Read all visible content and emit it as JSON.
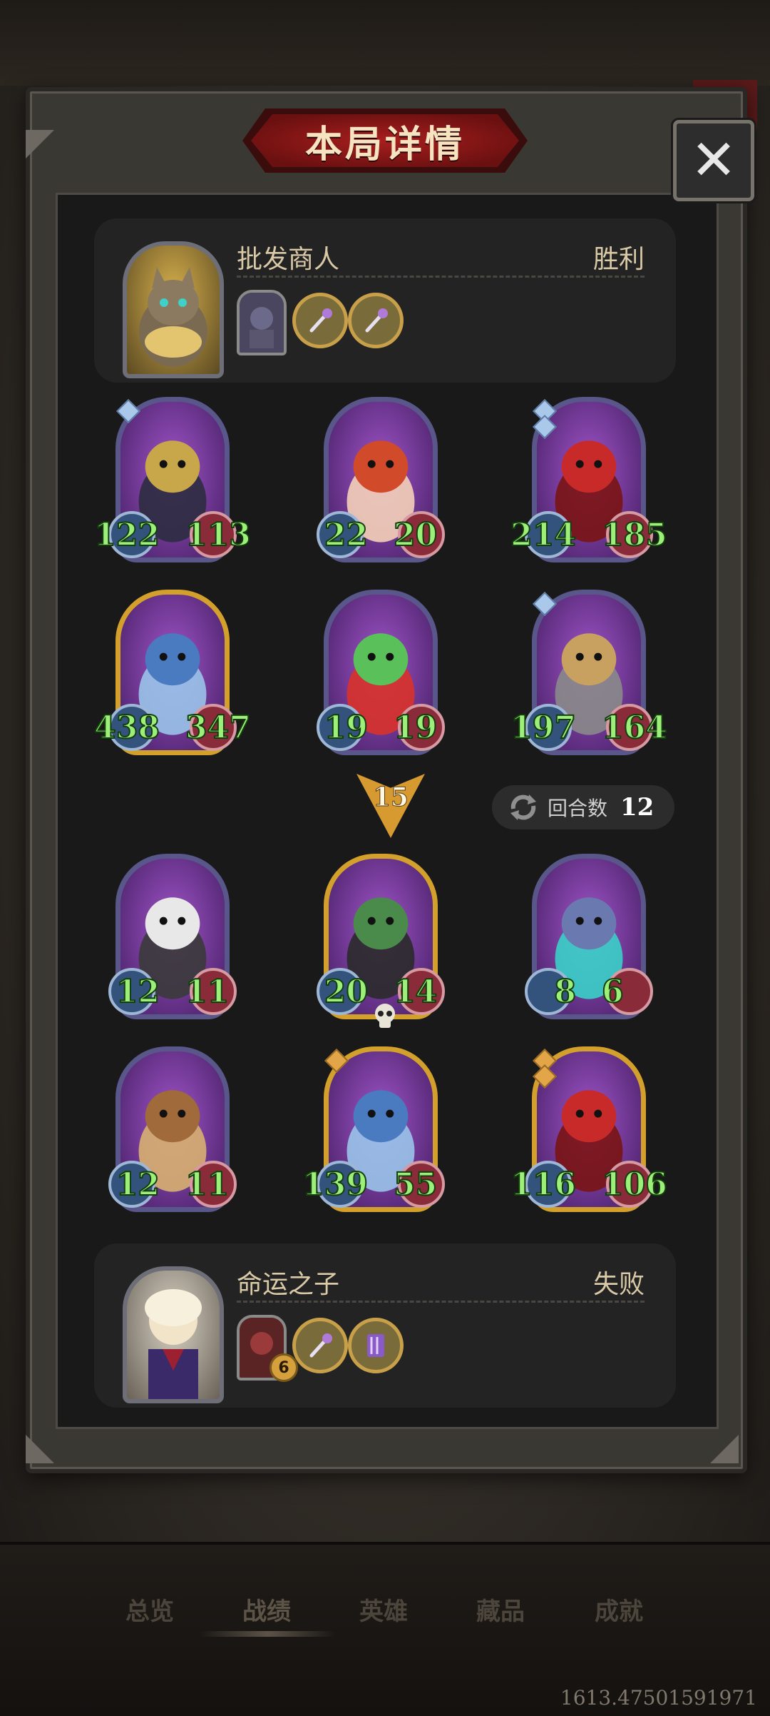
{
  "dialog": {
    "title": "本局详情",
    "close_label": "✕"
  },
  "top_player": {
    "name": "批发商人",
    "result": "胜利",
    "items": [
      {
        "icon": "card-portrait-icon",
        "type": "rect"
      },
      {
        "icon": "magic-wand-icon",
        "type": "circle"
      },
      {
        "icon": "magic-wand-icon",
        "type": "circle"
      }
    ]
  },
  "top_board": [
    {
      "name": "armored-knight",
      "attack": "122",
      "health": "113",
      "frame": "silver",
      "gems": 1
    },
    {
      "name": "red-haired-girl",
      "attack": "22",
      "health": "20",
      "frame": "silver",
      "gems": 0
    },
    {
      "name": "red-dragon",
      "attack": "214",
      "health": "185",
      "frame": "silver",
      "gems": 2
    },
    {
      "name": "blue-dragon",
      "attack": "438",
      "health": "347",
      "frame": "gold",
      "gems": 0
    },
    {
      "name": "apple-frog",
      "attack": "19",
      "health": "19",
      "frame": "silver",
      "gems": 0
    },
    {
      "name": "old-gambler",
      "attack": "197",
      "health": "164",
      "frame": "silver",
      "gems": 1
    }
  ],
  "round": {
    "number": "15",
    "turns_label": "回合数",
    "turns_value": "12"
  },
  "bottom_board": [
    {
      "name": "masked-rabbit",
      "attack": "12",
      "health": "11",
      "frame": "silver",
      "gems": 0
    },
    {
      "name": "witch",
      "attack": "20",
      "health": "14",
      "frame": "gold",
      "gems": 0,
      "dead": true
    },
    {
      "name": "shadow-beast",
      "attack": "8",
      "health": "6",
      "frame": "silver",
      "gems": 0
    },
    {
      "name": "reindeer",
      "attack": "12",
      "health": "11",
      "frame": "silver",
      "gems": 0
    },
    {
      "name": "blue-dragon",
      "attack": "139",
      "health": "55",
      "frame": "gold",
      "gems": 1
    },
    {
      "name": "red-dragon",
      "attack": "116",
      "health": "106",
      "frame": "gold",
      "gems": 2
    }
  ],
  "bottom_player": {
    "name": "命运之子",
    "result": "失败",
    "items": [
      {
        "icon": "card-portrait-icon",
        "type": "rect",
        "badge": "6"
      },
      {
        "icon": "magic-wand-icon",
        "type": "circle"
      },
      {
        "icon": "spellbook-icon",
        "type": "circle"
      }
    ]
  },
  "tabs": [
    "总览",
    "战绩",
    "英雄",
    "藏品",
    "成就"
  ],
  "active_tab": "战绩",
  "footer": {
    "version": "1613.47501591971"
  },
  "colors": {
    "stat_text": "#9cf07a",
    "title_red": "#a91e1e",
    "gold_frame": "#d4a02c",
    "silver_frame": "#59578a"
  }
}
